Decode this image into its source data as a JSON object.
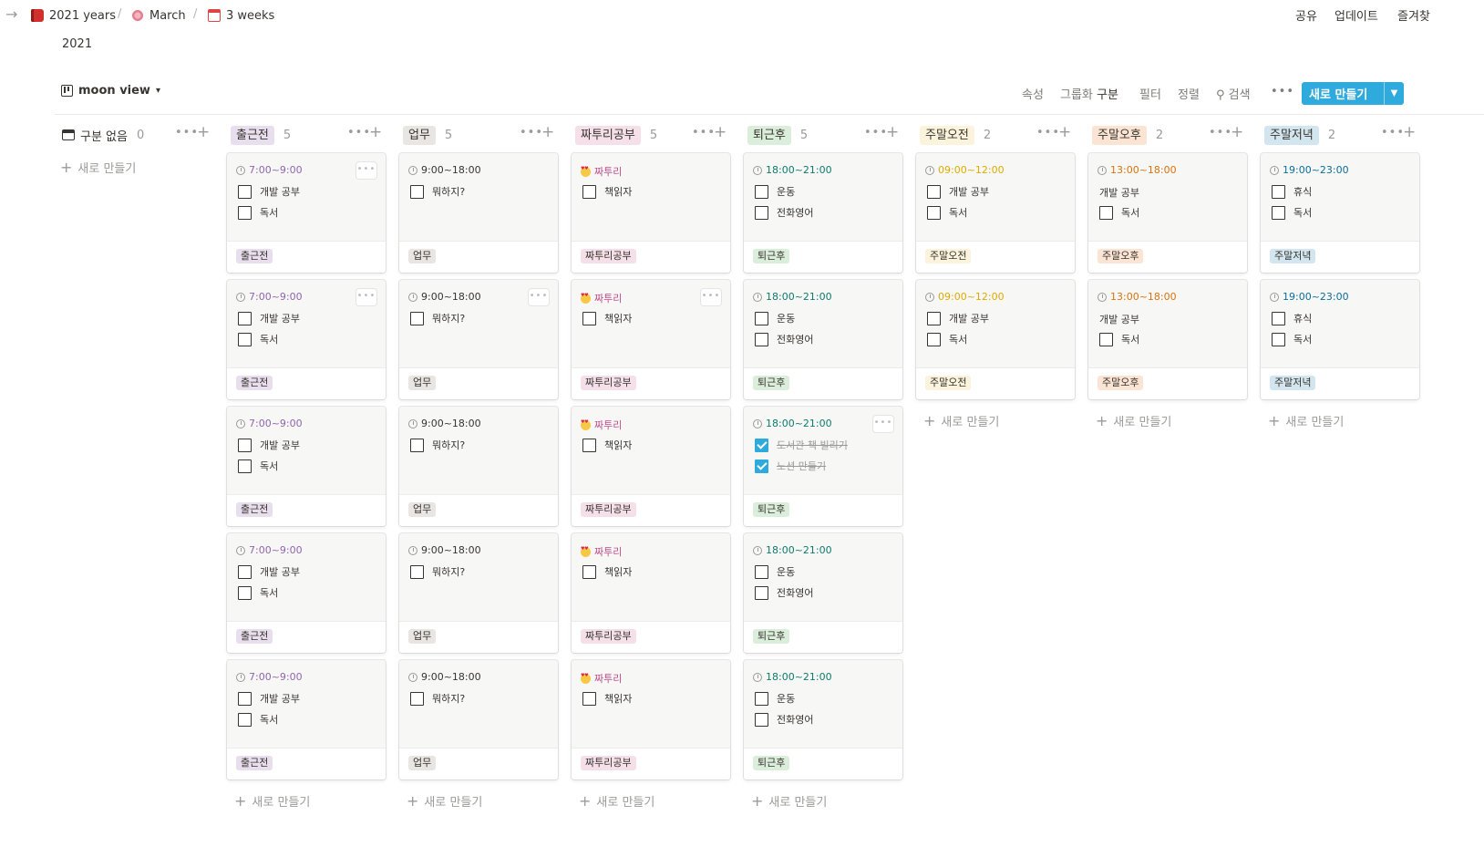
{
  "breadcrumb": {
    "items": [
      {
        "label": "2021 years",
        "icon": "book-icon"
      },
      {
        "label": "March",
        "icon": "flower-icon"
      },
      {
        "label": "3 weeks",
        "icon": "calendar-icon"
      }
    ],
    "separator": "/"
  },
  "top_actions": {
    "share": "공유",
    "updates": "업데이트",
    "favorite": "즐겨찾"
  },
  "page_subtitle": "2021",
  "view": {
    "name": "moon view"
  },
  "toolbar": {
    "properties": "속성",
    "group_prefix": "그룹화",
    "group_value": "구분",
    "filter": "필터",
    "sort": "정렬",
    "search": "검색",
    "more": "•••",
    "new": "새로 만들기"
  },
  "add_new_label": "새로 만들기",
  "no_group": {
    "label": "구분 없음",
    "count": "0"
  },
  "colors": {
    "purple": "#e8deee",
    "brown": "#e9e5e3",
    "pink": "#f5e0e9",
    "green": "#dbeddb",
    "yellow": "#fbf3db",
    "orange": "#fbe4d4",
    "blue": "#d3e5ef",
    "accent": "#2eaadc",
    "time_purple": "#9065b0",
    "time_gray": "#37352f",
    "time_pink": "#c14c8a",
    "time_green": "#0f7b6c",
    "time_yellow": "#dfab01",
    "time_orange": "#d9730d",
    "time_blue": "#0b6e99"
  },
  "columns": [
    {
      "name": "출근전",
      "count": "5",
      "color": "#e8deee",
      "time_color": "#9065b0",
      "cards": [
        {
          "title": "7:00~9:00",
          "icon": "clock-icon",
          "items": [
            {
              "text": "개발 공부",
              "done": false
            },
            {
              "text": "독서",
              "done": false
            }
          ]
        },
        {
          "title": "7:00~9:00",
          "icon": "clock-icon",
          "items": [
            {
              "text": "개발 공부",
              "done": false
            },
            {
              "text": "독서",
              "done": false
            }
          ]
        },
        {
          "title": "7:00~9:00",
          "icon": "clock-icon",
          "items": [
            {
              "text": "개발 공부",
              "done": false
            },
            {
              "text": "독서",
              "done": false
            }
          ]
        },
        {
          "title": "7:00~9:00",
          "icon": "clock-icon",
          "items": [
            {
              "text": "개발 공부",
              "done": false
            },
            {
              "text": "독서",
              "done": false
            }
          ]
        },
        {
          "title": "7:00~9:00",
          "icon": "clock-icon",
          "items": [
            {
              "text": "개발 공부",
              "done": false
            },
            {
              "text": "독서",
              "done": false
            }
          ]
        }
      ]
    },
    {
      "name": "업무",
      "count": "5",
      "color": "#e9e5e3",
      "time_color": "#37352f",
      "cards": [
        {
          "title": "9:00~18:00",
          "icon": "clock-icon",
          "items": [
            {
              "text": "뭐하지?",
              "done": false
            }
          ]
        },
        {
          "title": "9:00~18:00",
          "icon": "clock-icon",
          "items": [
            {
              "text": "뭐하지?",
              "done": false
            }
          ]
        },
        {
          "title": "9:00~18:00",
          "icon": "clock-icon",
          "items": [
            {
              "text": "뭐하지?",
              "done": false
            }
          ]
        },
        {
          "title": "9:00~18:00",
          "icon": "clock-icon",
          "items": [
            {
              "text": "뭐하지?",
              "done": false
            }
          ]
        },
        {
          "title": "9:00~18:00",
          "icon": "clock-icon",
          "items": [
            {
              "text": "뭐하지?",
              "done": false
            }
          ]
        }
      ]
    },
    {
      "name": "짜투리공부",
      "count": "5",
      "color": "#f5e0e9",
      "time_color": "#c14c8a",
      "cards": [
        {
          "title": "짜투리",
          "icon": "heart-eyes-emoji-icon",
          "items": [
            {
              "text": "책읽자",
              "done": false
            }
          ]
        },
        {
          "title": "짜투리",
          "icon": "heart-eyes-emoji-icon",
          "items": [
            {
              "text": "책읽자",
              "done": false
            }
          ]
        },
        {
          "title": "짜투리",
          "icon": "heart-eyes-emoji-icon",
          "items": [
            {
              "text": "책읽자",
              "done": false
            }
          ]
        },
        {
          "title": "짜투리",
          "icon": "heart-eyes-emoji-icon",
          "items": [
            {
              "text": "책읽자",
              "done": false
            }
          ]
        },
        {
          "title": "짜투리",
          "icon": "heart-eyes-emoji-icon",
          "items": [
            {
              "text": "책읽자",
              "done": false
            }
          ]
        }
      ]
    },
    {
      "name": "퇴근후",
      "count": "5",
      "color": "#dbeddb",
      "time_color": "#0f7b6c",
      "cards": [
        {
          "title": "18:00~21:00",
          "icon": "clock-icon",
          "items": [
            {
              "text": "운동",
              "done": false
            },
            {
              "text": "전화영어",
              "done": false
            }
          ]
        },
        {
          "title": "18:00~21:00",
          "icon": "clock-icon",
          "items": [
            {
              "text": "운동",
              "done": false
            },
            {
              "text": "전화영어",
              "done": false
            }
          ]
        },
        {
          "title": "18:00~21:00",
          "icon": "clock-icon",
          "items": [
            {
              "text": "도서관 책 빌리기",
              "done": true
            },
            {
              "text": "노션 만들기",
              "done": true
            }
          ]
        },
        {
          "title": "18:00~21:00",
          "icon": "clock-icon",
          "items": [
            {
              "text": "운동",
              "done": false
            },
            {
              "text": "전화영어",
              "done": false
            }
          ]
        },
        {
          "title": "18:00~21:00",
          "icon": "clock-icon",
          "items": [
            {
              "text": "운동",
              "done": false
            },
            {
              "text": "전화영어",
              "done": false
            }
          ]
        }
      ]
    },
    {
      "name": "주말오전",
      "count": "2",
      "color": "#fbf3db",
      "time_color": "#dfab01",
      "cards": [
        {
          "title": "09:00~12:00",
          "icon": "clock-icon",
          "items": [
            {
              "text": "개발 공부",
              "done": false
            },
            {
              "text": "독서",
              "done": false
            }
          ]
        },
        {
          "title": "09:00~12:00",
          "icon": "clock-icon",
          "items": [
            {
              "text": "개발 공부",
              "done": false
            },
            {
              "text": "독서",
              "done": false
            }
          ]
        }
      ]
    },
    {
      "name": "주말오후",
      "count": "2",
      "color": "#fbe4d4",
      "time_color": "#d9730d",
      "cards": [
        {
          "title": "13:00~18:00",
          "icon": "clock-icon",
          "plain": "개발 공부",
          "items": [
            {
              "text": "독서",
              "done": false
            }
          ]
        },
        {
          "title": "13:00~18:00",
          "icon": "clock-icon",
          "plain": "개발 공부",
          "items": [
            {
              "text": "독서",
              "done": false
            }
          ]
        }
      ]
    },
    {
      "name": "주말저녁",
      "count": "2",
      "color": "#d3e5ef",
      "time_color": "#0b6e99",
      "cards": [
        {
          "title": "19:00~23:00",
          "icon": "clock-icon",
          "items": [
            {
              "text": "휴식",
              "done": false
            },
            {
              "text": "독서",
              "done": false
            }
          ]
        },
        {
          "title": "19:00~23:00",
          "icon": "clock-icon",
          "items": [
            {
              "text": "휴식",
              "done": false
            },
            {
              "text": "독서",
              "done": false
            }
          ]
        }
      ]
    }
  ]
}
